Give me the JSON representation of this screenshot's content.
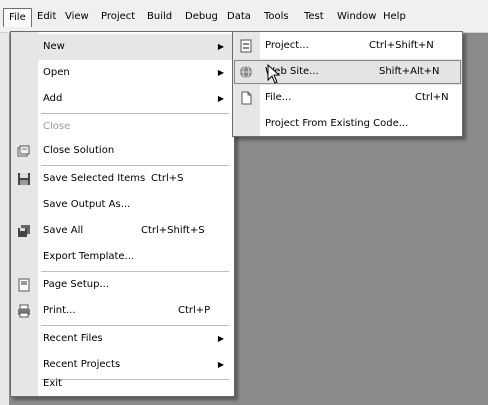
{
  "menubar": {
    "items": [
      {
        "label": "File",
        "open": true
      },
      {
        "label": "Edit"
      },
      {
        "label": "View"
      },
      {
        "label": "Project"
      },
      {
        "label": "Build"
      },
      {
        "label": "Debug"
      },
      {
        "label": "Data"
      },
      {
        "label": "Tools"
      },
      {
        "label": "Test"
      },
      {
        "label": "Window"
      },
      {
        "label": "Help"
      }
    ]
  },
  "file_menu": {
    "items": [
      {
        "label": "New",
        "submenu": true,
        "highlighted": true
      },
      {
        "label": "Open",
        "submenu": true
      },
      {
        "label": "Add",
        "submenu": true
      },
      {
        "label": "Close",
        "disabled": true
      },
      {
        "label": "Close Solution",
        "icon": "close-solution-icon"
      },
      {
        "label": "Save Selected Items",
        "shortcut": "Ctrl+S",
        "icon": "floppy-disk-icon"
      },
      {
        "label": "Save Output As..."
      },
      {
        "label": "Save All",
        "shortcut": "Ctrl+Shift+S",
        "icon": "save-all-icon"
      },
      {
        "label": "Export Template..."
      },
      {
        "label": "Page Setup...",
        "icon": "page-setup-icon"
      },
      {
        "label": "Print...",
        "shortcut": "Ctrl+P",
        "icon": "printer-icon"
      },
      {
        "label": "Recent Files",
        "submenu": true
      },
      {
        "label": "Recent Projects",
        "submenu": true
      },
      {
        "label": "Exit"
      }
    ]
  },
  "new_submenu": {
    "items": [
      {
        "label": "Project...",
        "shortcut": "Ctrl+Shift+N",
        "icon": "new-project-icon"
      },
      {
        "label": "Web Site...",
        "shortcut": "Shift+Alt+N",
        "icon": "globe-icon",
        "highlighted": true
      },
      {
        "label": "File...",
        "shortcut": "Ctrl+N",
        "icon": "new-file-icon"
      },
      {
        "label": "Project From Existing Code..."
      }
    ]
  },
  "glyphs": {
    "submenu_arrow": "▶"
  }
}
